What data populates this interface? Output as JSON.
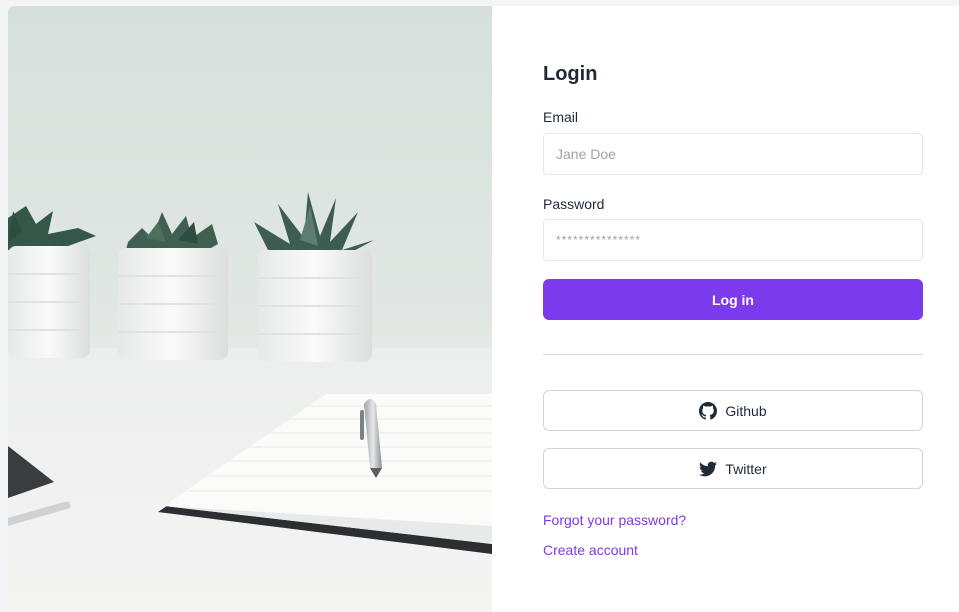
{
  "login": {
    "title": "Login",
    "email_label": "Email",
    "email_placeholder": "Jane Doe",
    "password_label": "Password",
    "password_placeholder": "***************",
    "login_button": "Log in",
    "github_button": "Github",
    "twitter_button": "Twitter",
    "forgot_link": "Forgot your password?",
    "create_link": "Create account"
  },
  "colors": {
    "accent": "#7c3aed",
    "text": "#1f2937",
    "border": "#d1d5db"
  },
  "icons": {
    "github": "github-icon",
    "twitter": "twitter-icon"
  }
}
